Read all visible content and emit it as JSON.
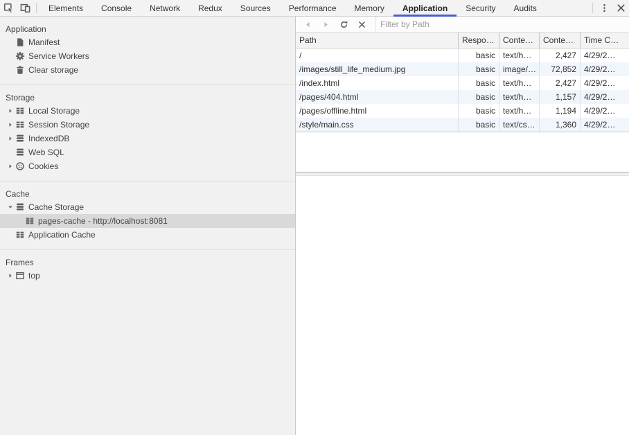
{
  "tabbar": {
    "tabs": [
      {
        "label": "Elements"
      },
      {
        "label": "Console"
      },
      {
        "label": "Network"
      },
      {
        "label": "Redux"
      },
      {
        "label": "Sources"
      },
      {
        "label": "Performance"
      },
      {
        "label": "Memory"
      },
      {
        "label": "Application",
        "active": true
      },
      {
        "label": "Security"
      },
      {
        "label": "Audits"
      }
    ],
    "left_icons": [
      "inspect",
      "device-toolbar"
    ],
    "right_icons": [
      "more",
      "close"
    ]
  },
  "sidebar": {
    "sections": [
      {
        "title": "Application",
        "items": [
          {
            "label": "Manifest",
            "icon": "manifest"
          },
          {
            "label": "Service Workers",
            "icon": "gear"
          },
          {
            "label": "Clear storage",
            "icon": "trash"
          }
        ]
      },
      {
        "title": "Storage",
        "items": [
          {
            "label": "Local Storage",
            "icon": "table",
            "arrow": "collapsed"
          },
          {
            "label": "Session Storage",
            "icon": "table",
            "arrow": "collapsed"
          },
          {
            "label": "IndexedDB",
            "icon": "database",
            "arrow": "collapsed"
          },
          {
            "label": "Web SQL",
            "icon": "database"
          },
          {
            "label": "Cookies",
            "icon": "cookie",
            "arrow": "collapsed"
          }
        ]
      },
      {
        "title": "Cache",
        "items": [
          {
            "label": "Cache Storage",
            "icon": "database",
            "arrow": "expanded"
          },
          {
            "label": "pages-cache - http://localhost:8081",
            "icon": "table",
            "nested": true,
            "selected": true
          },
          {
            "label": "Application Cache",
            "icon": "table"
          }
        ]
      },
      {
        "title": "Frames",
        "items": [
          {
            "label": "top",
            "icon": "frame",
            "arrow": "collapsed"
          }
        ]
      }
    ]
  },
  "grid_toolbar": {
    "icons": [
      "back",
      "forward",
      "refresh",
      "delete"
    ],
    "filter_placeholder": "Filter by Path"
  },
  "table": {
    "columns": [
      "Path",
      "Respo…",
      "Conte…",
      "Conte…",
      "Time C…"
    ],
    "rows": [
      [
        "/",
        "basic",
        "text/h…",
        "2,427",
        "4/29/2…"
      ],
      [
        "/images/still_life_medium.jpg",
        "basic",
        "image/…",
        "72,852",
        "4/29/2…"
      ],
      [
        "/index.html",
        "basic",
        "text/h…",
        "2,427",
        "4/29/2…"
      ],
      [
        "/pages/404.html",
        "basic",
        "text/h…",
        "1,157",
        "4/29/2…"
      ],
      [
        "/pages/offline.html",
        "basic",
        "text/h…",
        "1,194",
        "4/29/2…"
      ],
      [
        "/style/main.css",
        "basic",
        "text/cs…",
        "1,360",
        "4/29/2…"
      ]
    ]
  },
  "colors": {
    "accent_underline": "#485cd6",
    "toolbar_bg": "#f3f3f3",
    "sidebar_bg": "#f1f1f1",
    "sidebar_selected_bg": "#d9d9d9",
    "row_alt_bg": "#f1f5fc"
  }
}
